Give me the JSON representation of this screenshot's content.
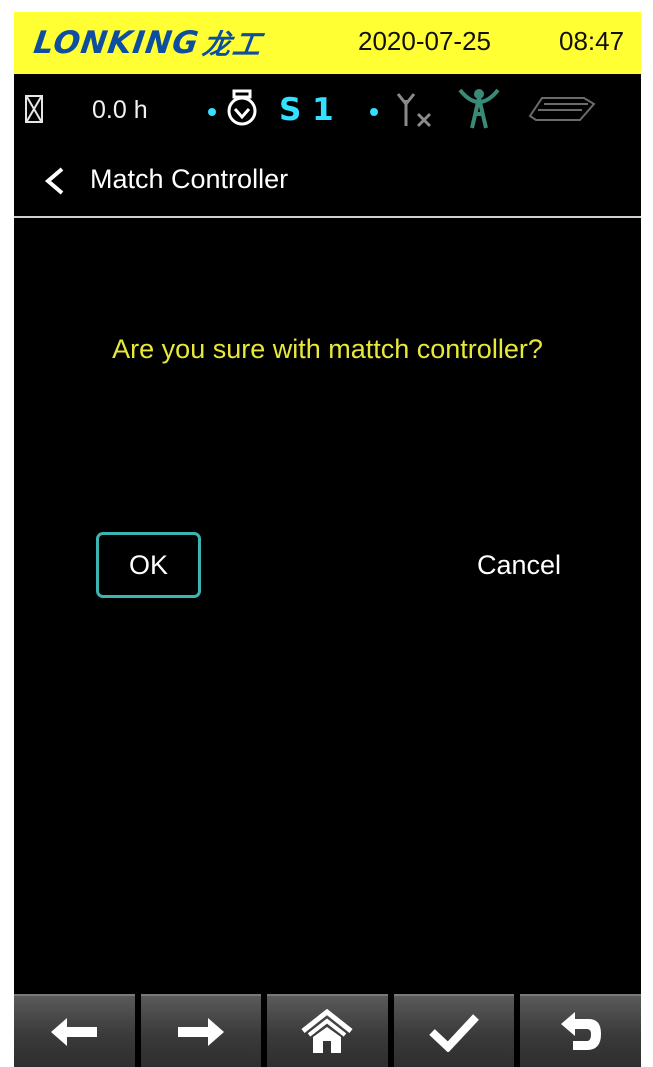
{
  "brand": {
    "logo_latin": "LONKING",
    "logo_cjk": "龙工",
    "date": "2020-07-25",
    "time": "08:47",
    "bar_color": "#ffff33",
    "logo_color": "#0d4ea0"
  },
  "status": {
    "hours": "0.0 h",
    "gear": "S 1",
    "accent_color": "#33e0ff",
    "icons": [
      "hourglass-icon",
      "engine-icon",
      "antenna-off-icon",
      "signal-tower-icon",
      "load-icon"
    ]
  },
  "header": {
    "back_icon": "chevron-left-icon",
    "title": "Match Controller"
  },
  "dialog": {
    "question": "Are you sure with mattch controller?",
    "ok_label": "OK",
    "cancel_label": "Cancel",
    "question_color": "#e8e83a",
    "focus_color": "#3cb5b0"
  },
  "toolbar": {
    "buttons": [
      "arrow-left-icon",
      "arrow-right-icon",
      "home-icon",
      "check-icon",
      "return-icon"
    ]
  }
}
